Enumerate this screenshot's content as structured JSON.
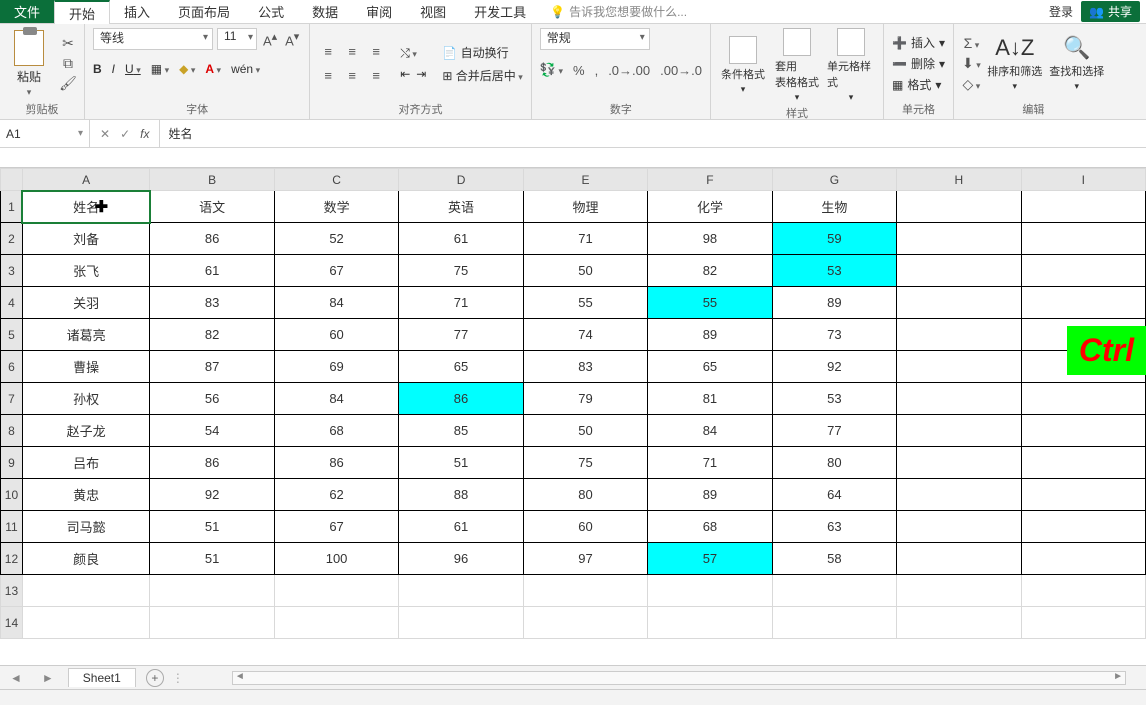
{
  "menu": {
    "file": "文件",
    "tabs": [
      "开始",
      "插入",
      "页面布局",
      "公式",
      "数据",
      "审阅",
      "视图",
      "开发工具"
    ],
    "tellme_icon": "💡",
    "tellme": "告诉我您想要做什么...",
    "login": "登录",
    "share": "共享"
  },
  "ribbon": {
    "clipboard": {
      "paste": "粘贴",
      "label": "剪贴板"
    },
    "font": {
      "name": "等线",
      "size": "11",
      "label": "字体",
      "bold": "B",
      "italic": "I",
      "underline": "U",
      "wen": "wén"
    },
    "align": {
      "label": "对齐方式",
      "wrap": "自动换行",
      "merge": "合并后居中"
    },
    "number": {
      "format": "常规",
      "label": "数字"
    },
    "styles": {
      "cond": "条件格式",
      "table": "套用\n表格格式",
      "cell": "单元格样式",
      "label": "样式"
    },
    "cells": {
      "insert": "插入",
      "delete": "删除",
      "format": "格式",
      "label": "单元格"
    },
    "editing": {
      "sort": "排序和筛选",
      "find": "查找和选择",
      "label": "编辑"
    }
  },
  "formulabar": {
    "ref": "A1",
    "value": "姓名"
  },
  "grid": {
    "cols": [
      "A",
      "B",
      "C",
      "D",
      "E",
      "F",
      "G",
      "H",
      "I"
    ],
    "headers": [
      "姓名",
      "语文",
      "数学",
      "英语",
      "物理",
      "化学",
      "生物"
    ],
    "rows": [
      {
        "n": "刘备",
        "v": [
          86,
          52,
          61,
          71,
          98,
          59
        ],
        "hl": [
          5
        ]
      },
      {
        "n": "张飞",
        "v": [
          61,
          67,
          75,
          50,
          82,
          53
        ],
        "hl": [
          5
        ]
      },
      {
        "n": "关羽",
        "v": [
          83,
          84,
          71,
          55,
          55,
          89
        ],
        "hl": [
          4
        ]
      },
      {
        "n": "诸葛亮",
        "v": [
          82,
          60,
          77,
          74,
          89,
          73
        ],
        "hl": []
      },
      {
        "n": "曹操",
        "v": [
          87,
          69,
          65,
          83,
          65,
          92
        ],
        "hl": []
      },
      {
        "n": "孙权",
        "v": [
          56,
          84,
          86,
          79,
          81,
          53
        ],
        "hl": [
          2
        ]
      },
      {
        "n": "赵子龙",
        "v": [
          54,
          68,
          85,
          50,
          84,
          77
        ],
        "hl": []
      },
      {
        "n": "吕布",
        "v": [
          86,
          86,
          51,
          75,
          71,
          80
        ],
        "hl": []
      },
      {
        "n": "黄忠",
        "v": [
          92,
          62,
          88,
          80,
          89,
          64
        ],
        "hl": []
      },
      {
        "n": "司马懿",
        "v": [
          51,
          67,
          61,
          60,
          68,
          63
        ],
        "hl": []
      },
      {
        "n": "颜良",
        "v": [
          51,
          100,
          96,
          97,
          57,
          58
        ],
        "hl": [
          4
        ]
      }
    ]
  },
  "sheets": {
    "tab": "Sheet1"
  },
  "overlay": {
    "ctrl": "Ctrl"
  }
}
